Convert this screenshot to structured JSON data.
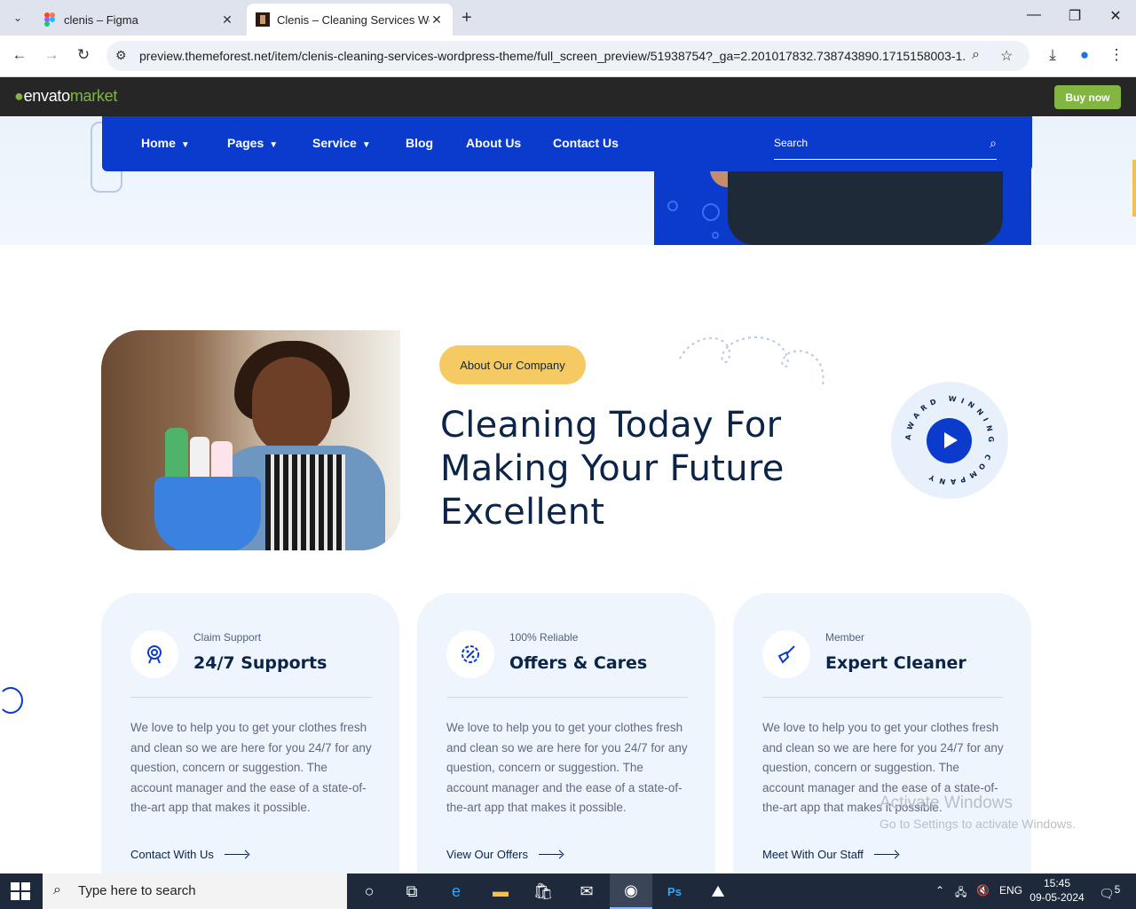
{
  "browser": {
    "tabs": [
      {
        "title": "clenis – Figma",
        "active": false
      },
      {
        "title": "Clenis – Cleaning Services Word",
        "active": true
      }
    ],
    "url": "preview.themeforest.net/item/clenis-cleaning-services-wordpress-theme/full_screen_preview/51938754?_ga=2.201017832.738743890.1715158003-1..."
  },
  "envato": {
    "logo_text": "envato",
    "logo_suffix": "market",
    "buy_label": "Buy now"
  },
  "nav": {
    "items": [
      {
        "label": "Home",
        "dropdown": true
      },
      {
        "label": "Pages",
        "dropdown": true
      },
      {
        "label": "Service",
        "dropdown": true
      },
      {
        "label": "Blog",
        "dropdown": false
      },
      {
        "label": "About Us",
        "dropdown": false
      },
      {
        "label": "Contact Us",
        "dropdown": false
      }
    ],
    "search_placeholder": "Search"
  },
  "about": {
    "badge": "About Our Company",
    "title": "Cleaning Today For Making Your Future Excellent",
    "ring_text": "AWARD WINNING COMPANY"
  },
  "cards": [
    {
      "kicker": "Claim Support",
      "title": "24/7 Supports",
      "icon": "support-icon",
      "body": "We love to help you to get your clothes fresh and clean so we are here for you 24/7 for any question, concern or suggestion. The account manager and the ease of a state-of-the-art app that makes it possible.",
      "cta": "Contact With Us"
    },
    {
      "kicker": "100% Reliable",
      "title": "Offers & Cares",
      "icon": "discount-icon",
      "body": "We love to help you to get your clothes fresh and clean so we are here for you 24/7 for any question, concern or suggestion. The account manager and the ease of a state-of-the-art app that makes it possible.",
      "cta": "View Our Offers"
    },
    {
      "kicker": "Member",
      "title": "Expert Cleaner",
      "icon": "broom-icon",
      "body": "We love to help you to get your clothes fresh and clean so we are here for you 24/7 for any question, concern or suggestion. The account manager and the ease of a state-of-the-art app that makes it possible.",
      "cta": "Meet With Our Staff"
    }
  ],
  "watermark": {
    "line1": "Activate Windows",
    "line2": "Go to Settings to activate Windows."
  },
  "taskbar": {
    "search_placeholder": "Type here to search",
    "lang": "ENG",
    "time": "15:45",
    "date": "09-05-2024",
    "notifications": "5"
  },
  "colors": {
    "brand_blue": "#0a3bcd",
    "accent_yellow": "#f6ca62",
    "heading_navy": "#0b2447",
    "envato_green": "#82b541"
  }
}
